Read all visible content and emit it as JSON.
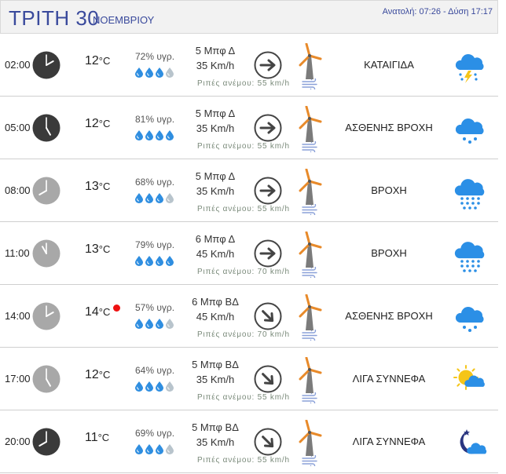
{
  "header": {
    "day": "ΤΡΙΤΗ 30",
    "month": "ΝΟΕΜΒΡΙΟΥ",
    "sun": "Ανατολή: 07:26  - Δύση 17:17"
  },
  "colors": {
    "accent": "#3a4a9c",
    "drop": "#2f8ee0",
    "drop_empty": "#b8c4cc",
    "clock_dark": "#3a3a3a",
    "clock_light": "#a8a8a8",
    "mill": "#e88a2a",
    "warning": "#e11111"
  },
  "rows": [
    {
      "time": "02:00",
      "clock": "dark",
      "hour": 2,
      "temp": "12",
      "unit": "°C",
      "warning": false,
      "hum": "72% υγρ.",
      "drops_full": 3,
      "wind_bft": "5 Μπφ Δ",
      "wind_kmh": "35 Km/h",
      "gust": "Ριπές ανέμου: 55 km/h",
      "arrow": "east",
      "condition": "ΚΑΤΑΙΓΙΔΑ",
      "icon": "thunderstorm-icon"
    },
    {
      "time": "05:00",
      "clock": "dark",
      "hour": 5,
      "temp": "12",
      "unit": "°C",
      "warning": false,
      "hum": "81% υγρ.",
      "drops_full": 4,
      "wind_bft": "5 Μπφ Δ",
      "wind_kmh": "35 Km/h",
      "gust": "Ριπές ανέμου: 55 km/h",
      "arrow": "east",
      "condition": "ΑΣΘΕΝΗΣ ΒΡΟΧΗ",
      "icon": "light-rain-icon"
    },
    {
      "time": "08:00",
      "clock": "light",
      "hour": 8,
      "temp": "13",
      "unit": "°C",
      "warning": false,
      "hum": "68% υγρ.",
      "drops_full": 3,
      "wind_bft": "5 Μπφ Δ",
      "wind_kmh": "35 Km/h",
      "gust": "Ριπές ανέμου: 55 km/h",
      "arrow": "east",
      "condition": "ΒΡΟΧΗ",
      "icon": "rain-icon"
    },
    {
      "time": "11:00",
      "clock": "light",
      "hour": 11,
      "temp": "13",
      "unit": "°C",
      "warning": false,
      "hum": "79% υγρ.",
      "drops_full": 4,
      "wind_bft": "6 Μπφ Δ",
      "wind_kmh": "45 Km/h",
      "gust": "Ριπές ανέμου: 70 km/h",
      "arrow": "east",
      "condition": "ΒΡΟΧΗ",
      "icon": "rain-icon"
    },
    {
      "time": "14:00",
      "clock": "light",
      "hour": 2,
      "temp": "14",
      "unit": "°C",
      "warning": true,
      "hum": "57% υγρ.",
      "drops_full": 3,
      "wind_bft": "6 Μπφ ΒΔ",
      "wind_kmh": "45 Km/h",
      "gust": "Ριπές ανέμου: 70 km/h",
      "arrow": "southeast",
      "condition": "ΑΣΘΕΝΗΣ ΒΡΟΧΗ",
      "icon": "light-rain-icon"
    },
    {
      "time": "17:00",
      "clock": "light",
      "hour": 5,
      "temp": "12",
      "unit": "°C",
      "warning": false,
      "hum": "64% υγρ.",
      "drops_full": 3,
      "wind_bft": "5 Μπφ ΒΔ",
      "wind_kmh": "35 Km/h",
      "gust": "Ριπές ανέμου: 55 km/h",
      "arrow": "southeast",
      "condition": "ΛΙΓΑ ΣΥΝΝΕΦΑ",
      "icon": "partly-cloudy-day-icon"
    },
    {
      "time": "20:00",
      "clock": "dark",
      "hour": 8,
      "temp": "11",
      "unit": "°C",
      "warning": false,
      "hum": "69% υγρ.",
      "drops_full": 3,
      "wind_bft": "5 Μπφ ΒΔ",
      "wind_kmh": "35 Km/h",
      "gust": "Ριπές ανέμου: 55 km/h",
      "arrow": "southeast",
      "condition": "ΛΙΓΑ ΣΥΝΝΕΦΑ",
      "icon": "partly-cloudy-night-icon"
    }
  ]
}
